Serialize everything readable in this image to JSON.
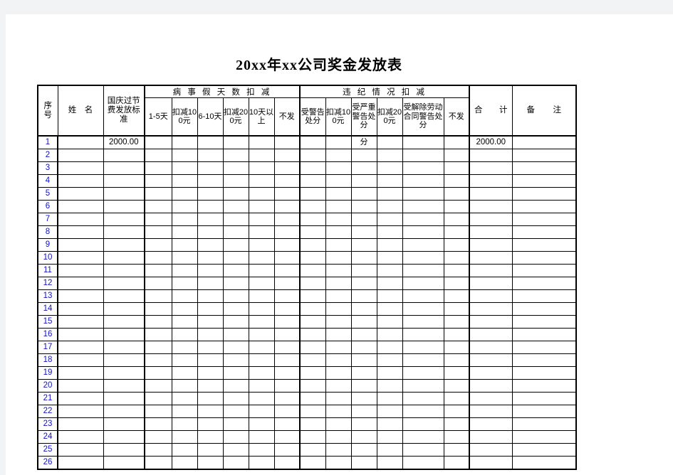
{
  "document": {
    "title": "20xx年xx公司奖金发放表"
  },
  "table": {
    "columns": {
      "index": "序号",
      "index_lines": [
        "序",
        "号"
      ],
      "name": "姓　名",
      "standard": "国庆过节费发放标准",
      "total": "合　计",
      "remark": "备　注"
    },
    "groups": [
      {
        "label": "病 事 假 天 数 扣 减",
        "subcolumns": [
          "1-5天",
          "扣减100元",
          "6-10天",
          "扣减200元",
          "10天以上",
          "不发"
        ]
      },
      {
        "label": "违 纪 情 况 扣 减",
        "subcolumns": [
          "受警告处分",
          "扣减100元",
          "受严重警告处分",
          "扣减200元",
          "受解除劳动合同警告处分",
          "不发"
        ]
      }
    ],
    "row_numbers": [
      1,
      2,
      3,
      4,
      5,
      6,
      7,
      8,
      9,
      10,
      11,
      12,
      13,
      14,
      15,
      16,
      17,
      18,
      19,
      20,
      21,
      22,
      23,
      24,
      25,
      26
    ],
    "rows": [
      {
        "index": "1",
        "name": "",
        "standard": "2000.00",
        "sick_1_5": "",
        "sick_deduct_100": "",
        "sick_6_10": "",
        "sick_deduct_200": "",
        "sick_over_10": "",
        "sick_none": "",
        "v_warning": "",
        "v_deduct_100": "",
        "v_serious": "",
        "v_deduct_200": "",
        "v_terminate": "",
        "v_none": "",
        "total": "2000.00",
        "remark": ""
      }
    ],
    "overflow_text": "分"
  },
  "colors": {
    "value_blue": "#0000ff",
    "index_blue": "#1111cc",
    "grid": "#000000",
    "page_background": "#ffffff",
    "canvas_background": "#f2f3f4"
  }
}
